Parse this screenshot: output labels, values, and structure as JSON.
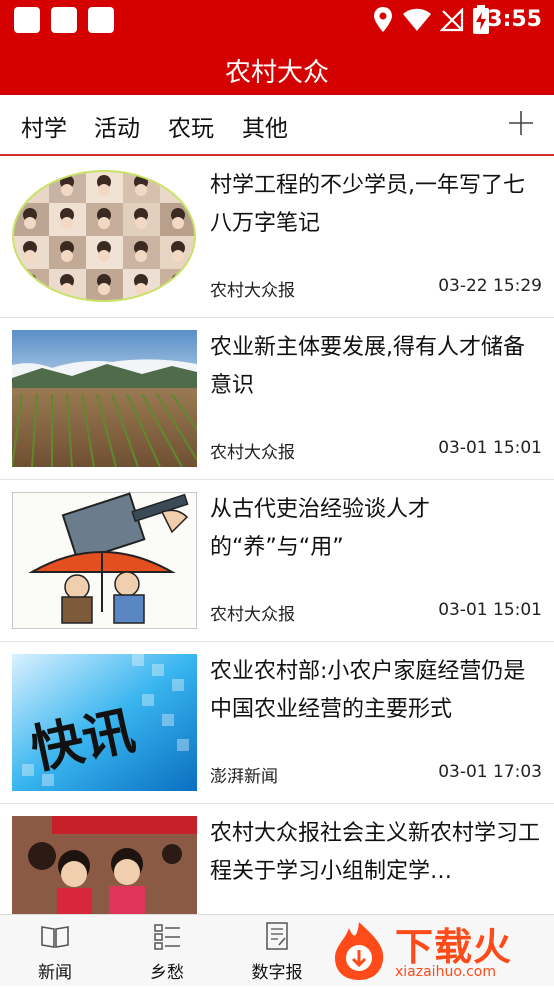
{
  "status_bar": {
    "time": "3:55"
  },
  "app": {
    "title": "农村大众"
  },
  "tabs": [
    {
      "label": "村学"
    },
    {
      "label": "活动"
    },
    {
      "label": "农玩"
    },
    {
      "label": "其他"
    }
  ],
  "news": [
    {
      "title": "村学工程的不少学员,一年写了七八万字笔记",
      "source": "农村大众报",
      "time": "03-22 15:29"
    },
    {
      "title": "农业新主体要发展,得有人才储备意识",
      "source": "农村大众报",
      "time": "03-01 15:01"
    },
    {
      "title": "从古代吏治经验谈人才的“养”与“用”",
      "source": "农村大众报",
      "time": "03-01 15:01"
    },
    {
      "title": "农业农村部:小农户家庭经营仍是中国农业经营的主要形式",
      "source": "澎湃新闻",
      "time": "03-01 17:03"
    },
    {
      "title": "农村大众报社会主义新农村学习工程关于学习小组制定学…",
      "source": "",
      "time": ""
    }
  ],
  "thumb4_text": "快讯",
  "bottom_nav": [
    {
      "label": "新闻"
    },
    {
      "label": "乡愁"
    },
    {
      "label": "数字报"
    }
  ],
  "watermark": {
    "text": "下载火",
    "url": "xiazaihuo.com"
  },
  "colors": {
    "primary": "#d50000",
    "watermark": "#ff4a1a"
  }
}
